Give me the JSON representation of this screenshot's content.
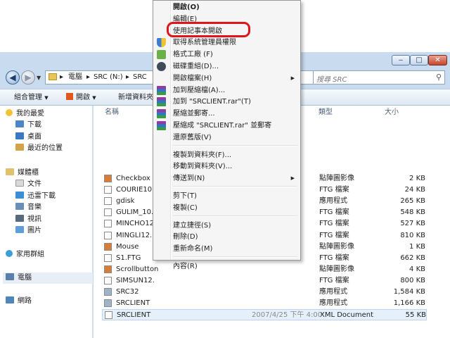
{
  "window": {
    "controls": {
      "minimize": "‒",
      "maximize": "□",
      "close": "✕"
    }
  },
  "navbar": {
    "breadcrumbs": [
      "電腦",
      "SRC (N:)",
      "SRC"
    ],
    "separator": "▸",
    "search_placeholder": "搜尋 SRC",
    "search_icon": "magnifier"
  },
  "toolbar": {
    "organize": "組合管理",
    "open": "開啟",
    "new_folder": "新增資料夾"
  },
  "nav_pane": {
    "favorites": {
      "label": "我的最愛",
      "items": [
        "下載",
        "桌面",
        "最近的位置"
      ]
    },
    "libraries": {
      "label": "媒體櫃",
      "items": [
        "文件",
        "迅雷下載",
        "音樂",
        "視訊",
        "圖片"
      ]
    },
    "homegroup": "家用群組",
    "computer": "電腦",
    "network": "網路"
  },
  "columns": {
    "name": "名稱",
    "type": "類型",
    "size": "大小"
  },
  "files": [
    {
      "name": "Checkbox",
      "type": "點陣圖影像",
      "size": "2 KB",
      "icon": "bitmap"
    },
    {
      "name": "COURIE10.F",
      "type": "FTG 檔案",
      "size": "24 KB",
      "icon": "file"
    },
    {
      "name": "gdisk",
      "type": "應用程式",
      "size": "265 KB",
      "icon": "file"
    },
    {
      "name": "GULIM_10.F",
      "type": "FTG 檔案",
      "size": "548 KB",
      "icon": "file"
    },
    {
      "name": "MINCHO12",
      "type": "FTG 檔案",
      "size": "527 KB",
      "icon": "file"
    },
    {
      "name": "MINGLI12.F",
      "type": "FTG 檔案",
      "size": "810 KB",
      "icon": "file"
    },
    {
      "name": "Mouse",
      "type": "點陣圖影像",
      "size": "1 KB",
      "icon": "bitmap"
    },
    {
      "name": "S1.FTG",
      "type": "FTG 檔案",
      "size": "662 KB",
      "icon": "file"
    },
    {
      "name": "Scrollbutton",
      "type": "點陣圖影像",
      "size": "4 KB",
      "icon": "bitmap"
    },
    {
      "name": "SIMSUN12.",
      "type": "FTG 檔案",
      "size": "800 KB",
      "icon": "file"
    },
    {
      "name": "SRC32",
      "type": "應用程式",
      "size": "1,584 KB",
      "icon": "app"
    },
    {
      "name": "SRCLIENT",
      "type": "應用程式",
      "size": "1,166 KB",
      "icon": "app"
    },
    {
      "name": "SRCLIENT",
      "type": "XML Document",
      "size": "55 KB",
      "icon": "xml",
      "selected": true,
      "date": "2007/4/25 下午 4:00"
    }
  ],
  "context_menu": {
    "groups": [
      [
        {
          "label": "開啟(O)",
          "bold": true
        },
        {
          "label": "編輯(E)"
        },
        {
          "label": "使用記事本開啟",
          "highlighted": true
        },
        {
          "label": "取得系統管理員權限",
          "icon": "shield"
        },
        {
          "label": "格式工廠 (F)",
          "icon": "format-factory"
        },
        {
          "label": "磁碟重組(D)...",
          "icon": "defrag"
        },
        {
          "label": "開啟檔案(H)",
          "submenu": true
        },
        {
          "label": "加到壓縮檔(A)...",
          "icon": "winrar"
        },
        {
          "label": "加到 \"SRCLIENT.rar\"(T)",
          "icon": "winrar"
        },
        {
          "label": "壓縮並郵寄...",
          "icon": "winrar"
        },
        {
          "label": "壓縮成 \"SRCLIENT.rar\" 並郵寄",
          "icon": "winrar"
        },
        {
          "label": "還原舊版(V)"
        }
      ],
      [
        {
          "label": "複製到資料夾(F)..."
        },
        {
          "label": "移動到資料夾(V)..."
        },
        {
          "label": "傳送到(N)",
          "submenu": true
        }
      ],
      [
        {
          "label": "剪下(T)"
        },
        {
          "label": "複製(C)"
        }
      ],
      [
        {
          "label": "建立捷徑(S)"
        },
        {
          "label": "刪除(D)"
        },
        {
          "label": "重新命名(M)"
        }
      ],
      [
        {
          "label": "內容(R)"
        }
      ]
    ]
  },
  "colors": {
    "highlight_ring": "#e0141b",
    "selection": "#e5f0fb",
    "menu_bg": "#f5f5f5",
    "window_frame": "#c9dbee"
  }
}
